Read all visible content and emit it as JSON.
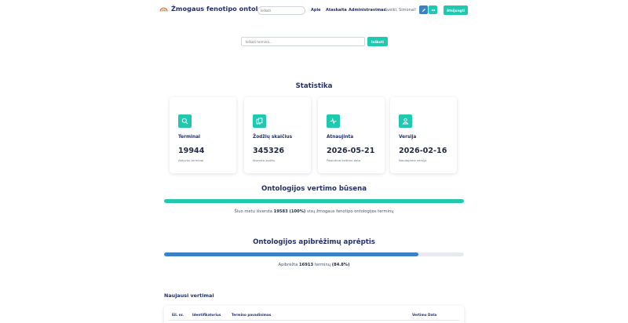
{
  "header": {
    "title": "Žmogaus fenotipo ontologija",
    "search_placeholder": "Ieškoti",
    "nav": [
      "Apie",
      "Ataskaita",
      "Administravimas"
    ],
    "user": "Sveiki, Simonai!",
    "logout_label": "Atsijungti"
  },
  "search": {
    "placeholder": "Ieškoti termino...",
    "button_label": "Ieškoti"
  },
  "stats": {
    "title": "Statistika",
    "cards": [
      {
        "icon": "search-icon",
        "label": "Terminai",
        "value": "19944",
        "sub": "Aktyvūs terminai"
      },
      {
        "icon": "documents-icon",
        "label": "Žodžių skaičius",
        "value": "345326",
        "sub": "Išversta žodžių"
      },
      {
        "icon": "activity-icon",
        "label": "Atnaujinta",
        "value": "2026-05-21",
        "sub": "Paskutinė keitimo data"
      },
      {
        "icon": "user-icon",
        "label": "Versija",
        "value": "2026-02-16",
        "sub": "Naudojama versija"
      }
    ]
  },
  "translation": {
    "title": "Ontologijos vertimo būsena",
    "progress": 1.0,
    "text_before": "Šiuo metu išversta ",
    "count": "19583 (100%)",
    "text_after": " visų žmogaus fenotipo ontologijos terminų"
  },
  "definitions": {
    "title": "Ontologijos apibrėžimų aprėptis",
    "progress": 0.848,
    "text_before": "Apibrėžta ",
    "count": "16913",
    "text_middle": " terminų ",
    "percent": "(84.8%)"
  },
  "recent": {
    "title": "Naujausi vertimai",
    "columns": [
      "Eil. nr.",
      "Identifikatorius",
      "Termino pavadinimas",
      "Vertimo Data"
    ]
  },
  "colors": {
    "accent": "#1ec9b0",
    "blue": "#3b82c4",
    "navy": "#233067"
  }
}
